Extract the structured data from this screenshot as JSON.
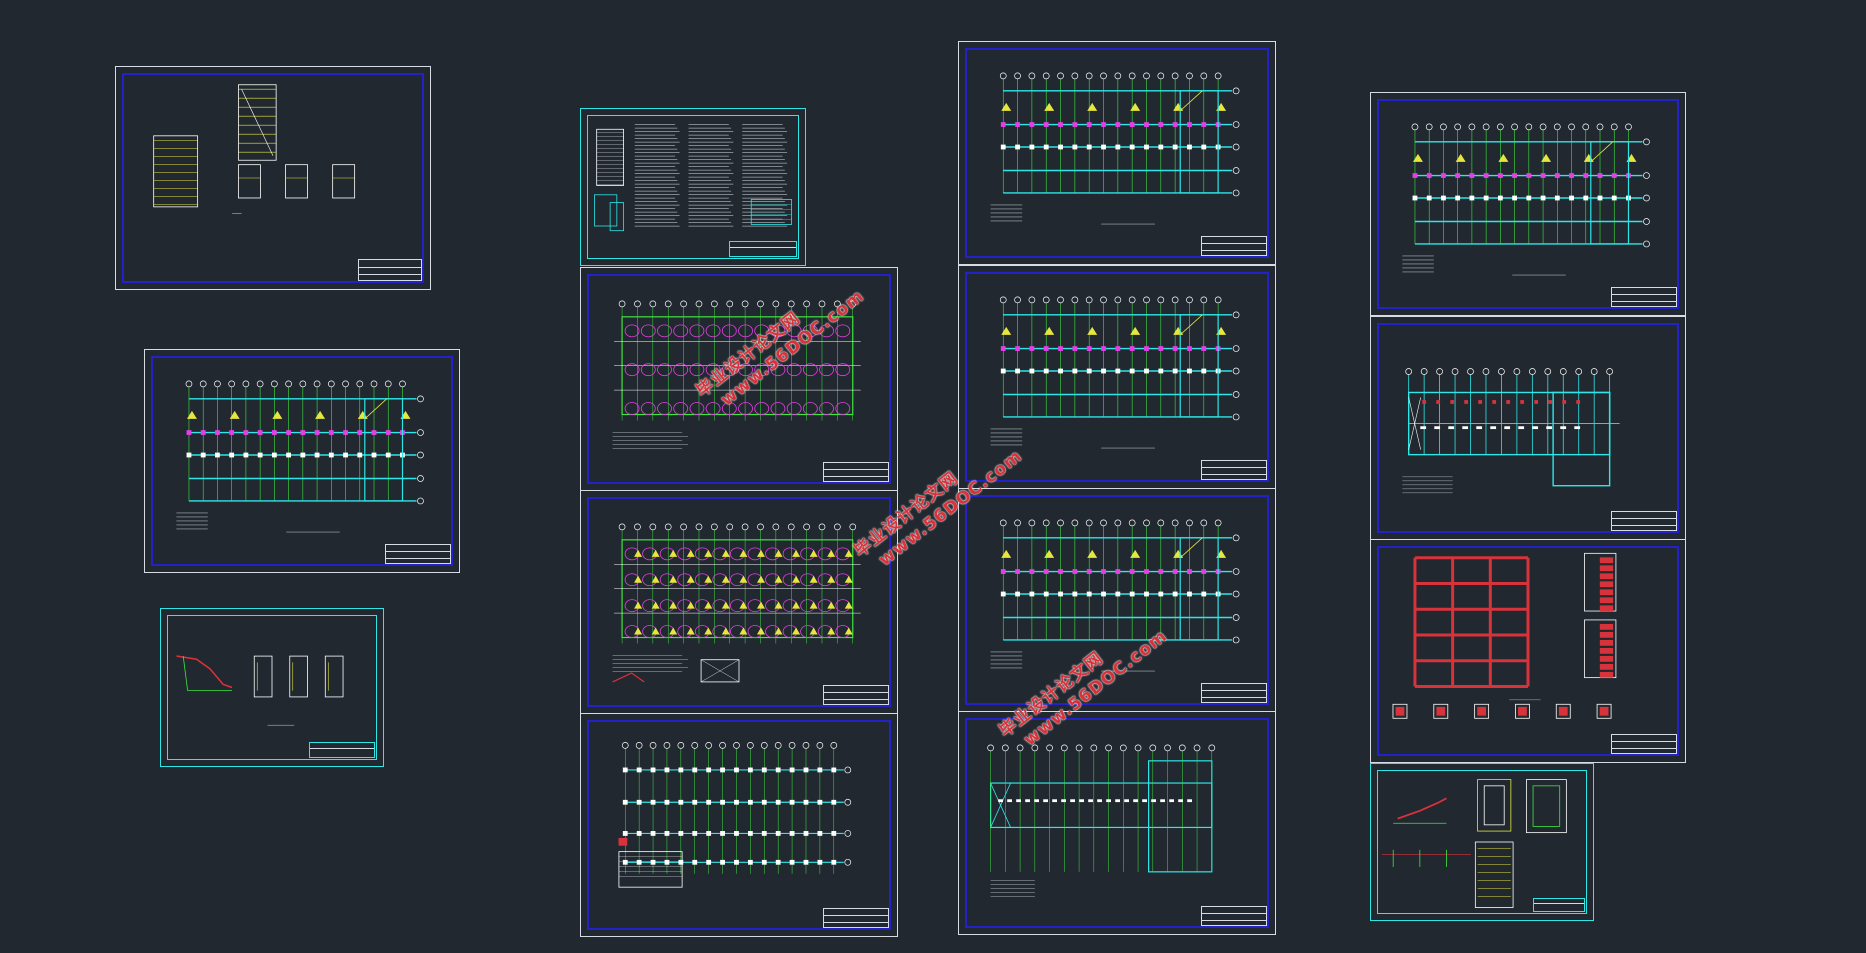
{
  "canvas": {
    "background": "#212830"
  },
  "watermarks": [
    {
      "cn": "毕业设计论文网",
      "url": "www.56DOC.com"
    },
    {
      "cn": "毕业设计论文网",
      "url": "www.56DOC.com"
    },
    {
      "cn": "毕业设计论文网",
      "url": "www.56DOC.com"
    }
  ],
  "colors": {
    "sheet_border": "#d6dbe4",
    "frame_blue": "#2222c8",
    "cyan": "#2ee6e6",
    "green": "#3ee63e",
    "yellow": "#e6e63e",
    "magenta": "#e63ee6",
    "red": "#d8323a",
    "watermark": "#d8323a"
  },
  "sheets": [
    {
      "id": "stair-sections",
      "kind": "stair"
    },
    {
      "id": "floor-plan-left",
      "kind": "plan"
    },
    {
      "id": "stair-detail-small",
      "kind": "stair-detail"
    },
    {
      "id": "general-notes",
      "kind": "notes"
    },
    {
      "id": "foundation-plan",
      "kind": "foundation"
    },
    {
      "id": "foundation-beam-plan",
      "kind": "foundation2"
    },
    {
      "id": "column-layout",
      "kind": "columns"
    },
    {
      "id": "plan-1",
      "kind": "plan"
    },
    {
      "id": "plan-2",
      "kind": "plan"
    },
    {
      "id": "plan-3",
      "kind": "plan"
    },
    {
      "id": "roof-plan",
      "kind": "roof"
    },
    {
      "id": "plan-right-top",
      "kind": "plan"
    },
    {
      "id": "slab-plan",
      "kind": "slab"
    },
    {
      "id": "frame-elevation",
      "kind": "frame"
    },
    {
      "id": "stair-detail-right",
      "kind": "stair-detail2"
    }
  ]
}
